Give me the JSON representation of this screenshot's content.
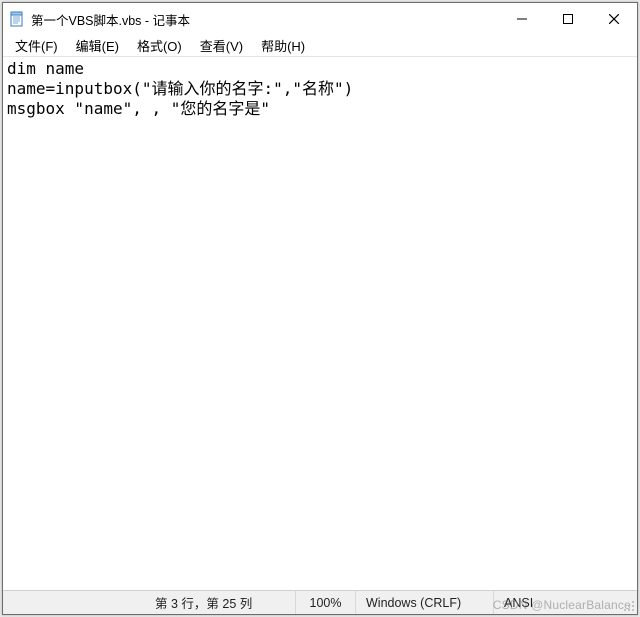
{
  "titlebar": {
    "title": "第一个VBS脚本.vbs - 记事本"
  },
  "menu": {
    "file": "文件(F)",
    "edit": "编辑(E)",
    "format": "格式(O)",
    "view": "查看(V)",
    "help": "帮助(H)"
  },
  "editor": {
    "content": "dim name\nname=inputbox(\"请输入你的名字:\",\"名称\")\nmsgbox \"name\", , \"您的名字是\""
  },
  "status": {
    "lncol": "第 3 行，第 25 列",
    "zoom": "100%",
    "eol": "Windows (CRLF)",
    "encoding": "ANSI"
  },
  "watermark": "CSDN @NuclearBalance"
}
